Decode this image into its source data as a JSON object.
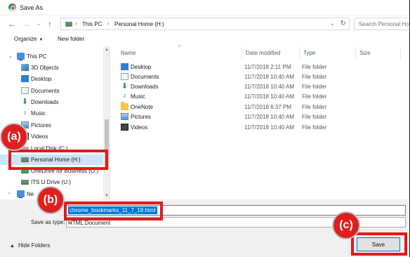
{
  "window": {
    "title": "Save As"
  },
  "address": {
    "crumbs": [
      "This PC",
      "Personal Home (H:)"
    ],
    "search_placeholder": "Search Personal Ho"
  },
  "toolbar": {
    "organize": "Organize",
    "new_folder": "New folder"
  },
  "nav": {
    "items": [
      {
        "label": "This PC",
        "icon": "pc-icon"
      },
      {
        "label": "3D Objects",
        "icon": "cube-icon"
      },
      {
        "label": "Desktop",
        "icon": "desktop-icon"
      },
      {
        "label": "Documents",
        "icon": "documents-icon"
      },
      {
        "label": "Downloads",
        "icon": "downloads-icon"
      },
      {
        "label": "Music",
        "icon": "music-icon"
      },
      {
        "label": "Pictures",
        "icon": "pictures-icon"
      },
      {
        "label": "Videos",
        "icon": "videos-icon"
      },
      {
        "label": "Local Disk (C:)",
        "icon": "disk-icon"
      },
      {
        "label": "Personal Home (H:)",
        "icon": "network-drive-icon"
      },
      {
        "label": "OneDrive for Business (O:)",
        "icon": "network-drive-icon"
      },
      {
        "label": "ITS U Drive (U:)",
        "icon": "network-drive-icon"
      },
      {
        "label": "Ne",
        "icon": "network-icon"
      }
    ]
  },
  "columns": {
    "name": "Name",
    "date": "Date modified",
    "type": "Type",
    "size": "Size"
  },
  "files": [
    {
      "name": "Desktop",
      "date": "11/7/2018 2:11 PM",
      "type": "File folder",
      "icon": "desktop-icon"
    },
    {
      "name": "Documents",
      "date": "11/7/2018 10:40 AM",
      "type": "File folder",
      "icon": "documents-icon"
    },
    {
      "name": "Downloads",
      "date": "11/7/2018 10:40 AM",
      "type": "File folder",
      "icon": "downloads-icon"
    },
    {
      "name": "Music",
      "date": "11/7/2018 10:40 AM",
      "type": "File folder",
      "icon": "music-icon"
    },
    {
      "name": "OneNote",
      "date": "11/7/2018 6:37 PM",
      "type": "File folder",
      "icon": "folder-icon"
    },
    {
      "name": "Pictures",
      "date": "11/7/2018 10:40 AM",
      "type": "File folder",
      "icon": "pictures-icon"
    },
    {
      "name": "Videos",
      "date": "11/7/2018 10:40 AM",
      "type": "File folder",
      "icon": "videos-icon"
    }
  ],
  "form": {
    "filename_label": "F",
    "filename_value": "chrome_bookmarks_11_7_18.html",
    "savetype_label": "Save as type:",
    "savetype_value": "HTML Document"
  },
  "footer": {
    "hide_folders": "Hide Folders",
    "save": "Save"
  },
  "annotations": {
    "a": "(a)",
    "b": "(b)",
    "c": "(c)"
  },
  "colors": {
    "highlight": "#e11b1b",
    "selection": "#0078d7",
    "nav_selected": "#cce4f7"
  }
}
